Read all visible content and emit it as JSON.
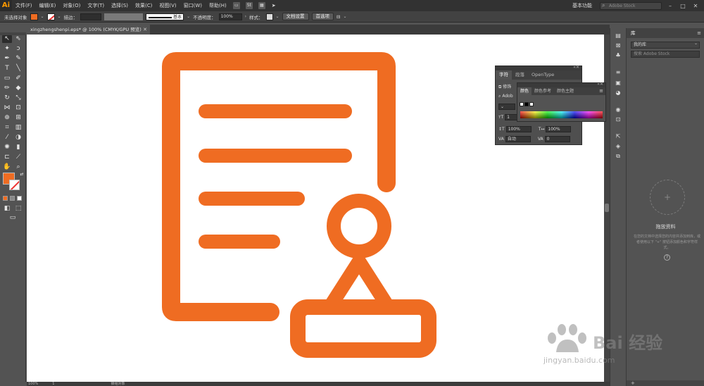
{
  "app": {
    "logo": "Ai",
    "menu": [
      "文件(F)",
      "编辑(E)",
      "对象(O)",
      "文字(T)",
      "选择(S)",
      "效果(C)",
      "视图(V)",
      "窗口(W)",
      "帮助(H)"
    ],
    "bridge_label": "Br",
    "stock_label": "St",
    "workspace": "基本功能",
    "stock_search_placeholder": "Adobe Stock"
  },
  "control": {
    "selection_state": "未选择对象",
    "stroke_label": "描边：",
    "stroke_style": "基本",
    "opacity_label": "不透明度：",
    "opacity_value": "100%",
    "style_label": "样式：",
    "doc_setup_button": "文档设置",
    "prefs_button": "首选项"
  },
  "document": {
    "tab_title": "xingzhengshenpi.eps* @ 100% (CMYK/GPU 预览)",
    "zoom": "100%",
    "artboard_num": "1",
    "status": "锁组对象"
  },
  "colors": {
    "fill": "#ef6c22",
    "icon": "#ef6c22"
  },
  "character_panel": {
    "tabs": [
      "字符",
      "段落",
      "OpenType"
    ],
    "font_prefix": "Adob",
    "row_a": "修饰",
    "scale_v": "100%",
    "scale_h": "100%",
    "auto": "自动",
    "tracking": "0",
    "size_prefix": "1"
  },
  "color_panel": {
    "tabs": [
      "颜色",
      "颜色参考",
      "颜色主题"
    ]
  },
  "libraries": {
    "title": "库",
    "selected": "我的库",
    "search_placeholder": "搜索 Adobe Stock",
    "drop_title": "拖放资料",
    "drop_desc": "在您的文档中选择您的内容并添加到库，或者使用以下 \"+\" 按钮添加颜色和字符样式。",
    "info": "?"
  },
  "watermark": {
    "brand": "Bai 经验",
    "url": "jingyan.baidu.com"
  }
}
